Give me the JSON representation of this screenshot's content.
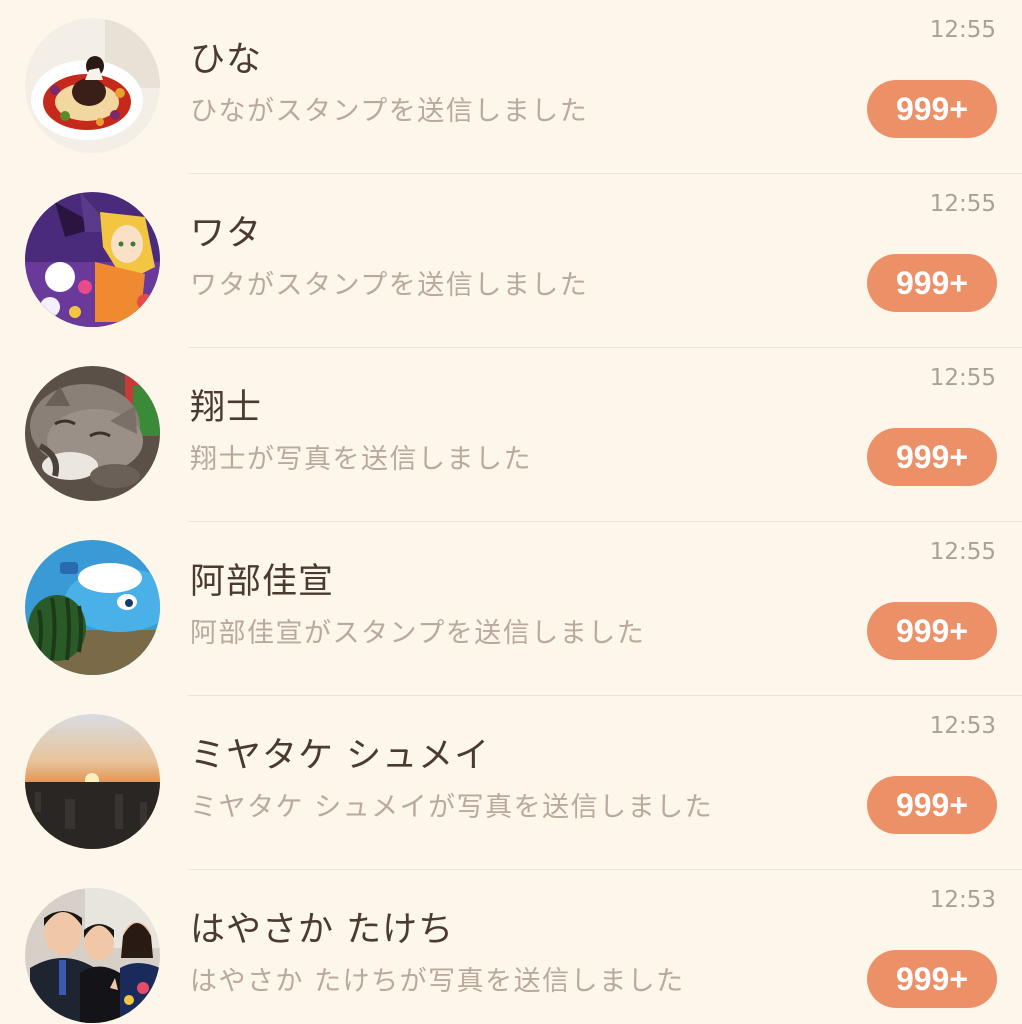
{
  "chats": [
    {
      "name": "ひな",
      "preview": "ひながスタンプを送信しました",
      "time": "12:55",
      "badge": "999+",
      "avatar": "dessert-plate-photo"
    },
    {
      "name": "ワタ",
      "preview": "ワタがスタンプを送信しました",
      "time": "12:55",
      "badge": "999+",
      "avatar": "anime-witch-illustration"
    },
    {
      "name": "翔士",
      "preview": "翔士が写真を送信しました",
      "time": "12:55",
      "badge": "999+",
      "avatar": "sleeping-kittens-photo"
    },
    {
      "name": "阿部佳宣",
      "preview": "阿部佳宣がスタンプを送信しました",
      "time": "12:55",
      "badge": "999+",
      "avatar": "watermelon-pool-float-photo"
    },
    {
      "name": "ミヤタケ シュメイ",
      "preview": "ミヤタケ シュメイが写真を送信しました",
      "time": "12:53",
      "badge": "999+",
      "avatar": "sunset-cityscape-photo"
    },
    {
      "name": "はやさか たけち",
      "preview": "はやさか たけちが写真を送信しました",
      "time": "12:53",
      "badge": "999+",
      "avatar": "group-of-friends-photo"
    }
  ],
  "colors": {
    "background": "#fdf6ea",
    "badge": "#ec9068",
    "name_text": "#4a3a30",
    "preview_text": "#b9aa9b",
    "time_text": "#a9a199"
  }
}
